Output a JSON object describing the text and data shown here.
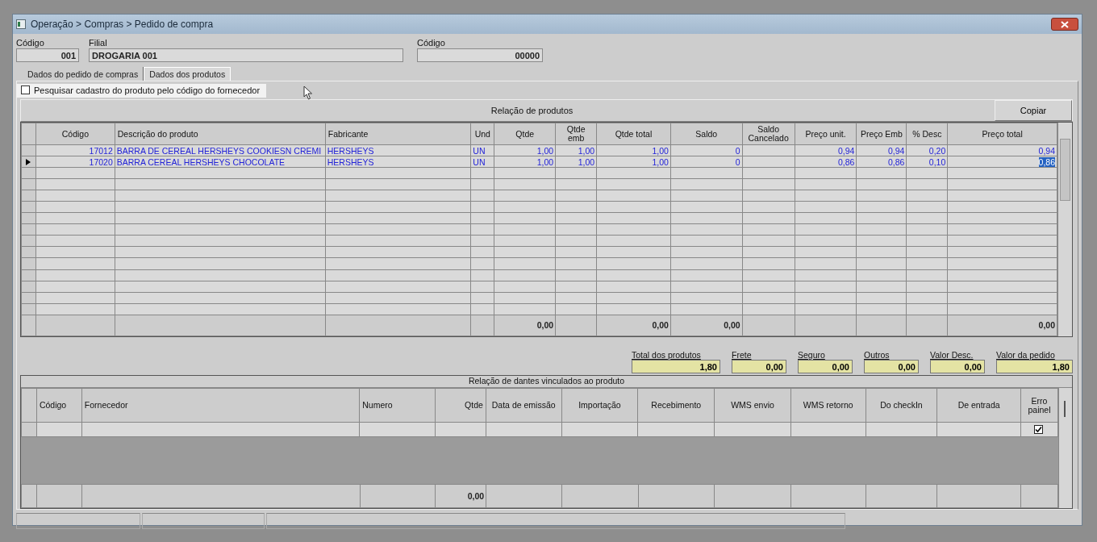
{
  "window": {
    "title": "Operação > Compras > Pedido de compra"
  },
  "header_fields": [
    {
      "label": "Código",
      "value": "001",
      "kind": "code"
    },
    {
      "label": "Filial",
      "value": "DROGARIA 001",
      "kind": "name"
    },
    {
      "label": "Código",
      "value": "00000",
      "kind": "order"
    }
  ],
  "tabs": [
    {
      "label": "Dados do pedido de compras",
      "selected": false
    },
    {
      "label": "Dados dos produtos",
      "selected": true
    }
  ],
  "supplier_search": {
    "label": "Pesquisar cadastro do produto pelo código do fornecedor",
    "checked": false
  },
  "products": {
    "title": "Relação de produtos",
    "copy_button": "Copiar",
    "columns": [
      {
        "label": "Código"
      },
      {
        "label": "Descrição do produto"
      },
      {
        "label": "Fabricante"
      },
      {
        "label": "Und"
      },
      {
        "label": "Qtde",
        "total": "0,00"
      },
      {
        "label": "Qtde emb"
      },
      {
        "label": "Qtde total",
        "total": "0,00"
      },
      {
        "label": "Saldo",
        "total": "0,00"
      },
      {
        "label": "Saldo Cancelado"
      },
      {
        "label": "Preço unit."
      },
      {
        "label": "Preço Emb"
      },
      {
        "label": "% Desc"
      },
      {
        "label": "Preço total",
        "total": "0,00"
      }
    ],
    "rows": [
      {
        "selected": false,
        "cells": [
          "17012",
          "BARRA DE CEREAL HERSHEYS COOKIESN CREMI",
          "HERSHEYS",
          "UN",
          "1,00",
          "1,00",
          "1,00",
          "0",
          null,
          "0,94",
          "0,94",
          "0,20",
          "0,94"
        ]
      },
      {
        "selected": true,
        "cells": [
          "17020",
          "BARRA CEREAL HERSHEYS CHOCOLATE",
          "HERSHEYS",
          "UN",
          "1,00",
          "1,00",
          "1,00",
          "0",
          null,
          "0,86",
          "0,86",
          "0,10",
          "0,86"
        ]
      }
    ]
  },
  "totals": [
    {
      "label": "Total dos produtos",
      "value": "1,80"
    },
    {
      "label": "Frete",
      "value": "0,00"
    },
    {
      "label": "Seguro",
      "value": "0,00"
    },
    {
      "label": "Outros",
      "value": "0,00"
    },
    {
      "label": "Valor Desc.",
      "value": "0,00"
    },
    {
      "label": "Valor da pedido",
      "value": "1,80"
    }
  ],
  "linked_invoices": {
    "title": "Relação de dantes vinculados ao produto",
    "columns": [
      {
        "label": "Código"
      },
      {
        "label": "Fornecedor"
      },
      {
        "label": "Numero"
      },
      {
        "label": "Qtde",
        "total": "0,00"
      },
      {
        "label": "Data de emissão"
      },
      {
        "label": "Importação"
      },
      {
        "label": "Recebimento"
      },
      {
        "label": "WMS envio"
      },
      {
        "label": "WMS retorno"
      },
      {
        "label": "Do checkIn"
      },
      {
        "label": "De entrada"
      },
      {
        "label": "Erro painel"
      }
    ],
    "rows": [
      {
        "erro_painel": true
      }
    ]
  }
}
